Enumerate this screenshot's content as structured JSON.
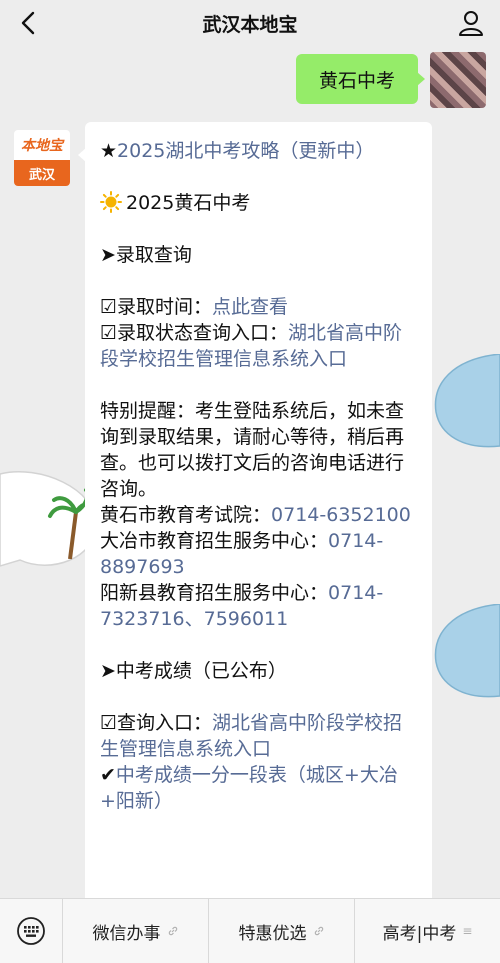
{
  "header": {
    "title": "武汉本地宝"
  },
  "conversation": {
    "my_message": "黄石中考",
    "bot_avatar": {
      "logo_text": "本地宝",
      "city": "武汉"
    },
    "bot_message": {
      "line_guide_prefix": "★",
      "line_guide_link": "2025湖北中考攻略（更新中）",
      "line_heading_icon": "sun-icon",
      "line_heading": "2025黄石中考",
      "section1_title": "➤录取查询",
      "admit_time_label": "☑录取时间：",
      "admit_time_link": "点此查看",
      "admit_status_label": "☑录取状态查询入口：",
      "admit_status_link": "湖北省高中阶段学校招生管理信息系统入口",
      "reminder": "特别提醒：考生登陆系统后，如未查询到录取结果，请耐心等待，稍后再查。也可以拨打文后的咨询电话进行咨询。",
      "contacts": [
        {
          "name": "黄石市教育考试院：",
          "phone": "0714-6352100"
        },
        {
          "name": "大冶市教育招生服务中心：",
          "phone": "0714-8897693"
        },
        {
          "name": "阳新县教育招生服务中心：",
          "phone": "0714-7323716、7596011"
        }
      ],
      "section2_title": "➤中考成绩（已公布）",
      "score_entry_label": "☑查询入口：",
      "score_entry_link": "湖北省高中阶段学校招生管理信息系统入口",
      "score_table_prefix": "✔",
      "score_table_link": "中考成绩一分一段表（城区+大冶+阳新）"
    }
  },
  "bottom_menu": {
    "items": [
      {
        "label": "微信办事",
        "has_submenu": false
      },
      {
        "label": "特惠优选",
        "has_submenu": false
      },
      {
        "label": "高考|中考",
        "has_submenu": true
      }
    ]
  }
}
